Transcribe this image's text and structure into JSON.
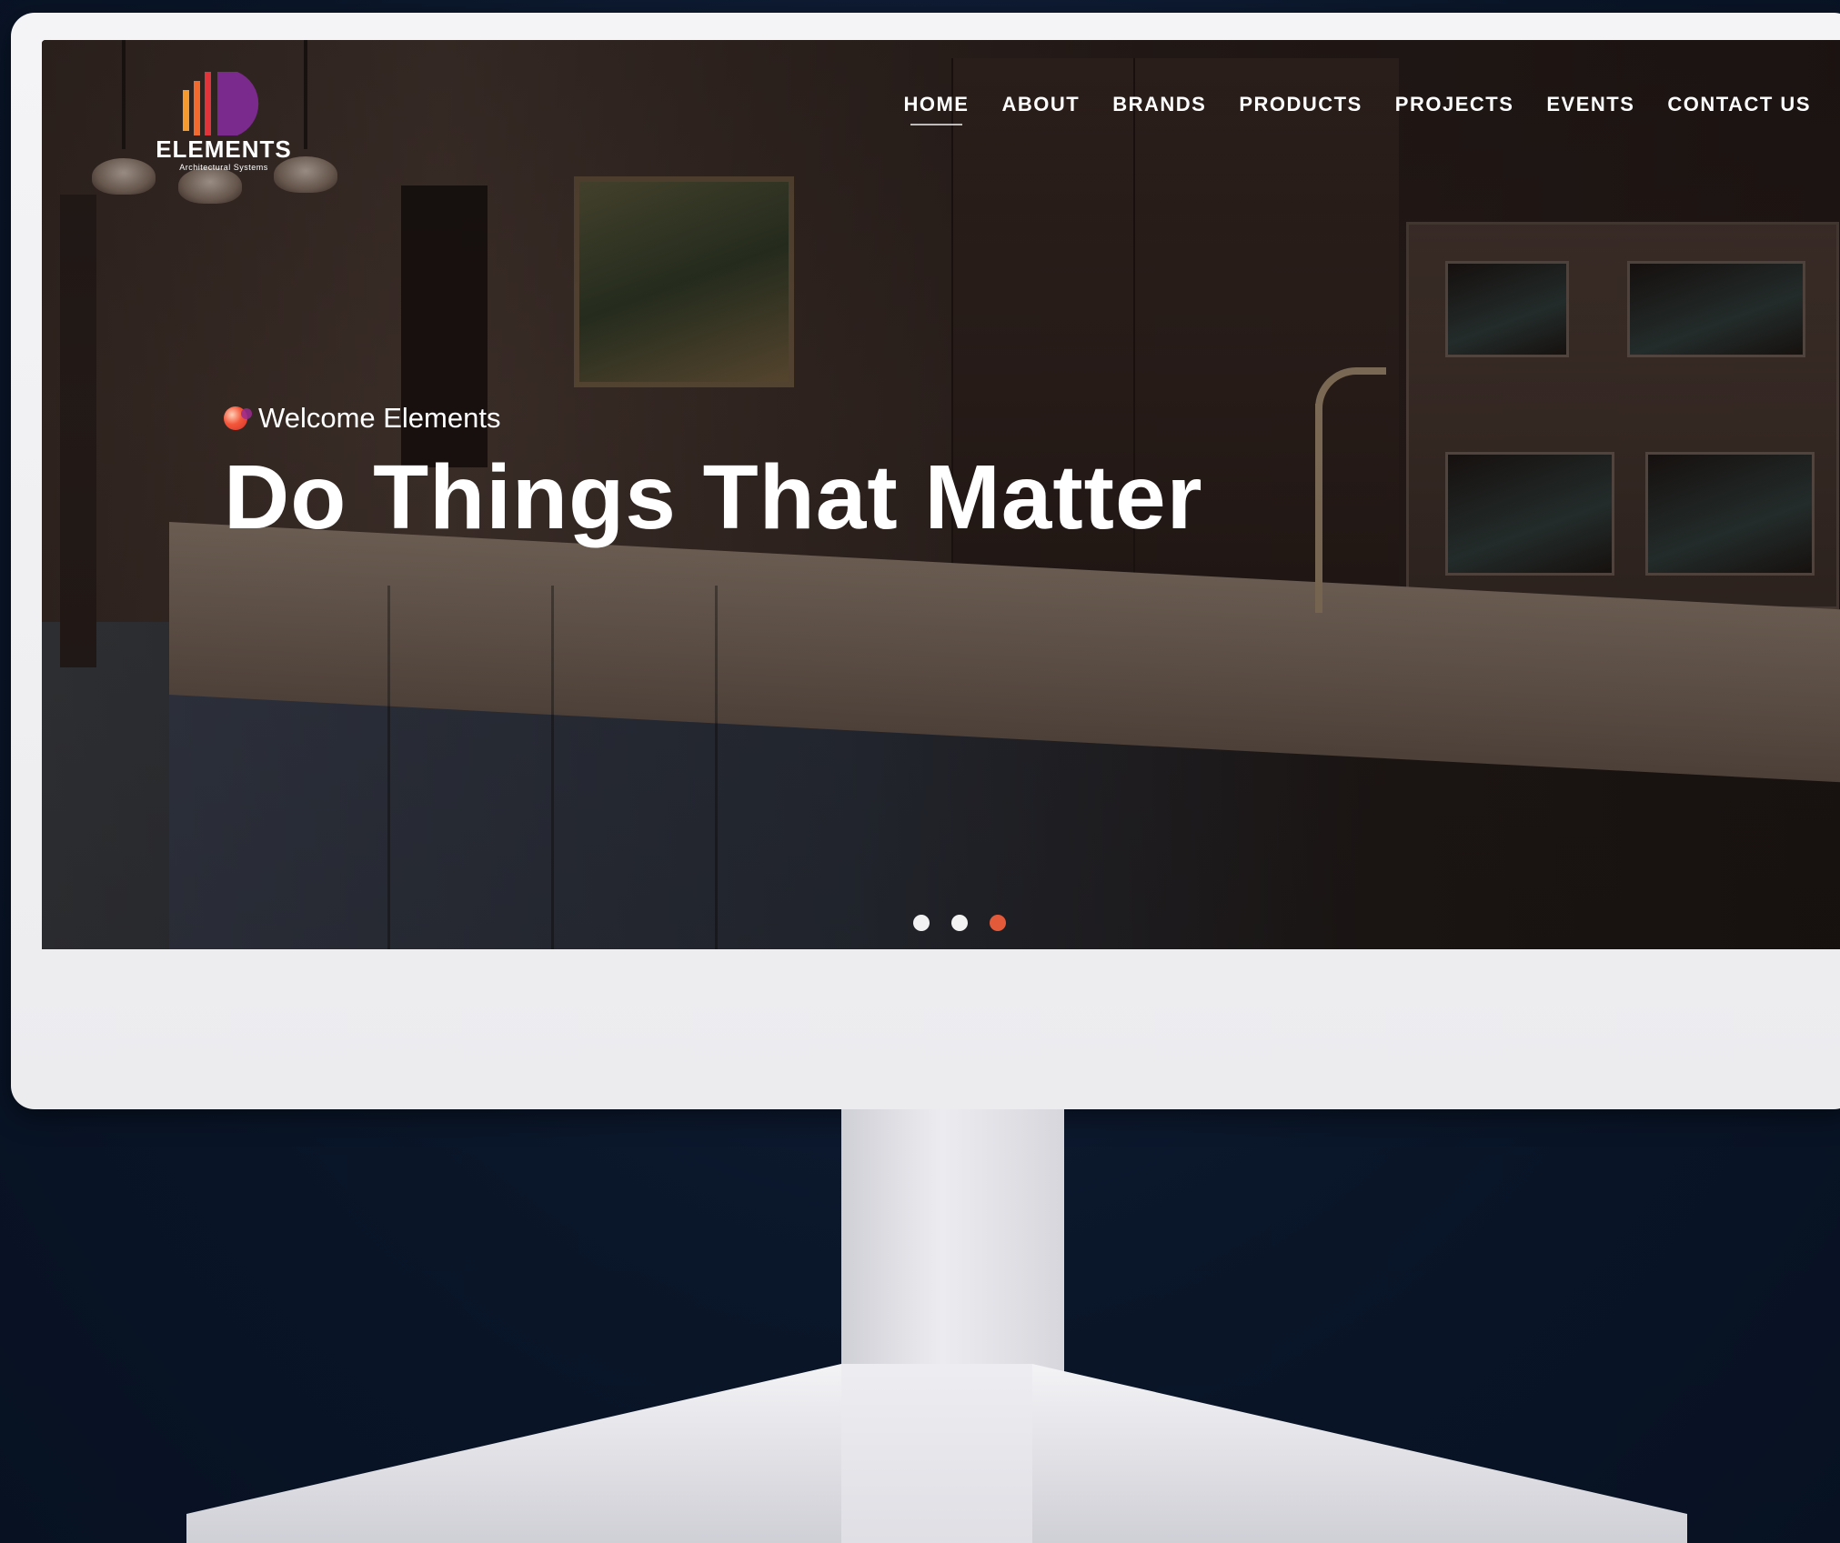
{
  "site": {
    "logo": {
      "name": "ELEMENTS",
      "tagline": "Architectural Systems"
    },
    "nav": [
      {
        "label": "HOME",
        "active": true
      },
      {
        "label": "ABOUT",
        "active": false
      },
      {
        "label": "BRANDS",
        "active": false
      },
      {
        "label": "PRODUCTS",
        "active": false
      },
      {
        "label": "PROJECTS",
        "active": false
      },
      {
        "label": "EVENTS",
        "active": false
      },
      {
        "label": "CONTACT US",
        "active": false
      }
    ]
  },
  "hero": {
    "eyebrow": "Welcome Elements",
    "headline": "Do Things That Matter",
    "slides": {
      "total": 3,
      "active": 3
    }
  },
  "colors": {
    "background": "#0b1830",
    "accent": "#e35a3a",
    "logo_orange": "#f59a2e",
    "logo_purple": "#7a2a8c"
  }
}
